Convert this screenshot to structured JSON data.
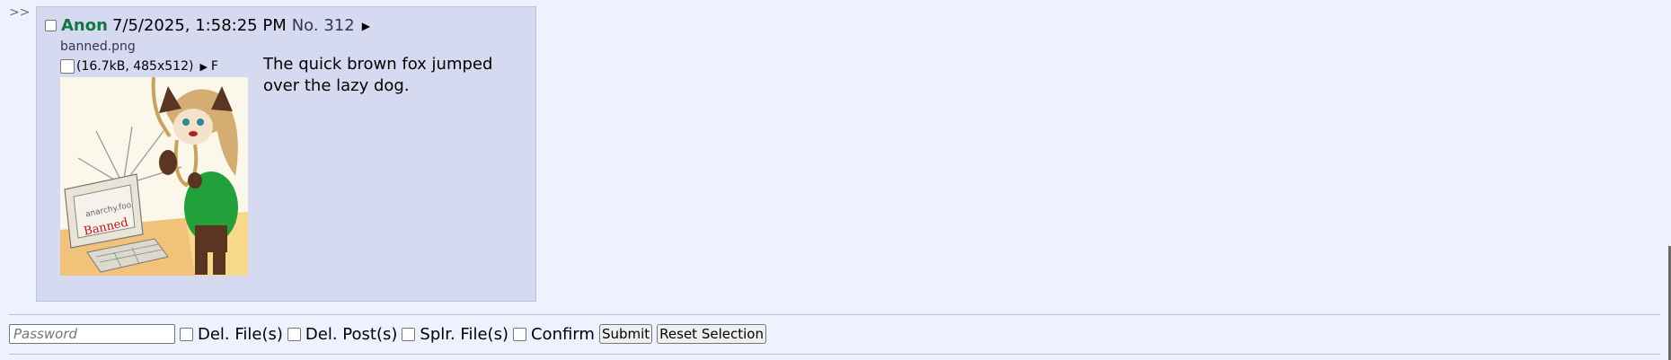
{
  "side_arrows": ">>",
  "post": {
    "name": "Anon",
    "date": "7/5/2025, 1:58:25 PM",
    "number": "No. 312",
    "menu_arrow": "▶",
    "filename": "banned.png",
    "file_info": "(16.7kB, 485x512)",
    "file_info_arrow": "▶",
    "file_info_suffix": "F",
    "thumbnail_text": "Banned",
    "message": "The quick brown fox jumped over the lazy dog."
  },
  "controls": {
    "password_placeholder": "Password",
    "del_files_label": "Del. File(s)",
    "del_posts_label": "Del. Post(s)",
    "spoiler_files_label": "Splr. File(s)",
    "confirm_label": "Confirm",
    "submit_label": "Submit",
    "reset_label": "Reset Selection"
  },
  "colors": {
    "post_bg": "#d6daf0",
    "name": "#117743",
    "page_bg": "#eef2ff"
  }
}
